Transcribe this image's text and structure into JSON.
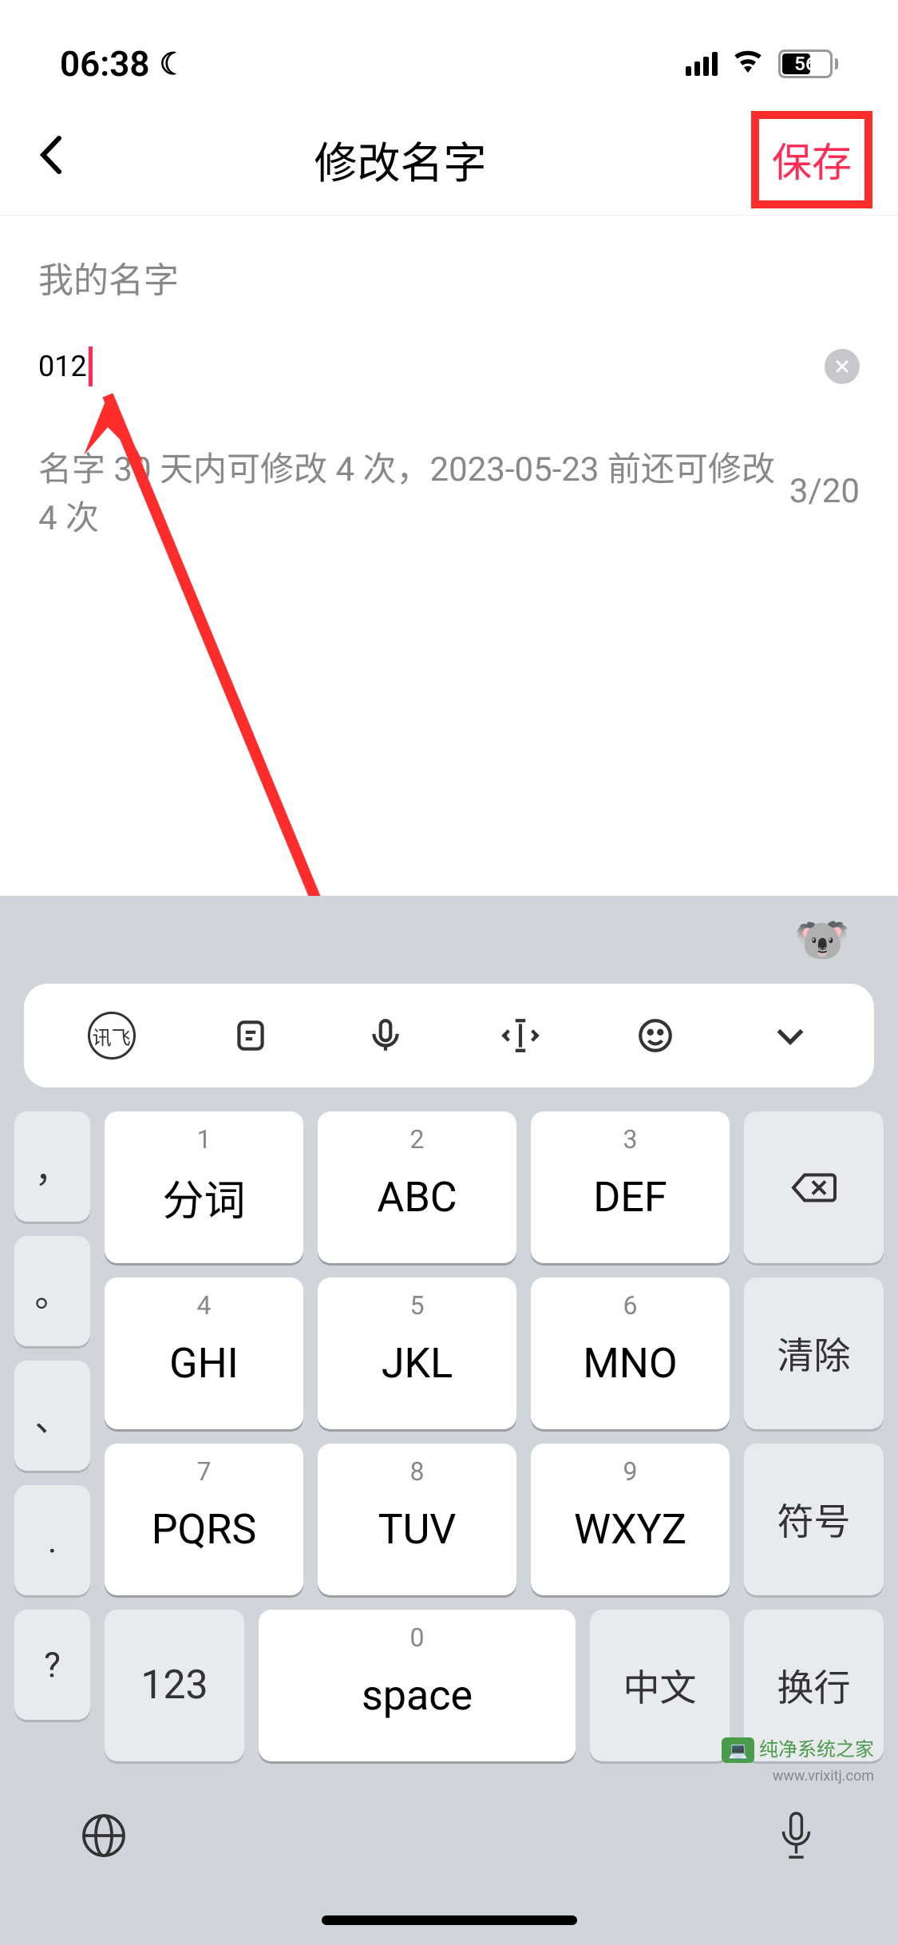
{
  "status_bar": {
    "time": "06:38",
    "battery_percent": "56",
    "battery_fill_percent": 56
  },
  "nav": {
    "title": "修改名字",
    "save_label": "保存"
  },
  "form": {
    "field_label": "我的名字",
    "input_value": "012",
    "helper_text": "名字 30 天内可修改 4 次，2023-05-23 前还可修改 4 次",
    "char_count": "3/20"
  },
  "keyboard": {
    "toolbar_badge": "讯飞",
    "keys": {
      "row1": [
        {
          "number": "1",
          "letters": "分词"
        },
        {
          "number": "2",
          "letters": "ABC"
        },
        {
          "number": "3",
          "letters": "DEF"
        }
      ],
      "row2": [
        {
          "number": "4",
          "letters": "GHI"
        },
        {
          "number": "5",
          "letters": "JKL"
        },
        {
          "number": "6",
          "letters": "MNO"
        }
      ],
      "row3": [
        {
          "number": "7",
          "letters": "PQRS"
        },
        {
          "number": "8",
          "letters": "TUV"
        },
        {
          "number": "9",
          "letters": "WXYZ"
        }
      ],
      "side_clear": "清除",
      "side_symbol": "符号",
      "side_enter": "换行",
      "num_label": "123",
      "space_number": "0",
      "space_label": "space",
      "lang_label": "中文",
      "punct": [
        "，",
        "。",
        "、",
        ".",
        "?"
      ]
    }
  },
  "watermark": {
    "text": "纯净系统之家",
    "url": "www.vrixitj.com"
  }
}
